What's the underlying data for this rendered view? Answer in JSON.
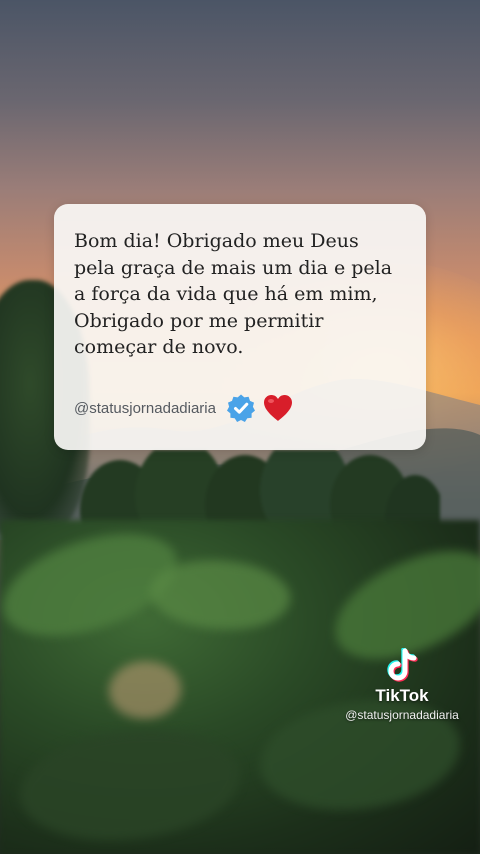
{
  "card": {
    "lines": [
      "Bom dia! Obrigado meu Deus",
      "pela graça de mais um dia e pela",
      "a força da vida que há em mim,",
      "Obrigado por me permitir",
      "começar de novo."
    ],
    "handle": "@statusjornadadiaria",
    "verified_icon": "verified-badge-icon",
    "heart_icon": "red-heart-icon"
  },
  "watermark": {
    "logo_icon": "tiktok-logo-icon",
    "brand": "TikTok",
    "handle": "@statusjornadadiaria"
  },
  "colors": {
    "verified_blue": "#4aa3e8",
    "heart_red": "#d81e2a",
    "card_background": "#faf8f6",
    "text": "#222222"
  }
}
